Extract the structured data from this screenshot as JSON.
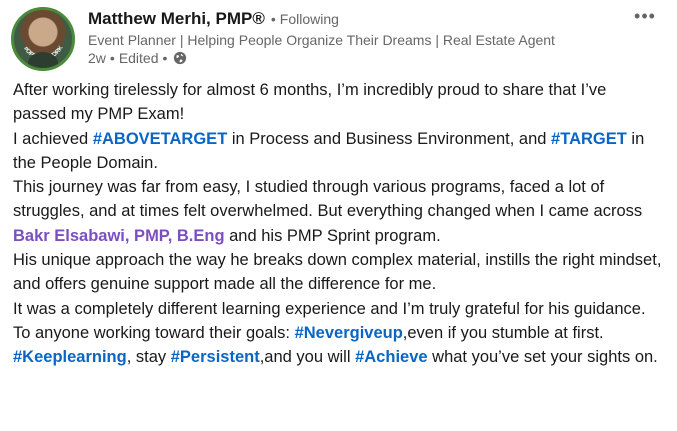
{
  "author": {
    "name": "Matthew Merhi, PMP®",
    "follow_sep": "•",
    "follow_status": "Following",
    "headline": "Event Planner | Helping People Organize Their Dreams | Real Estate Agent",
    "time": "2w",
    "meta_sep": "•",
    "edited": "Edited",
    "meta_sep2": "•",
    "avatar_badge": "#OPENTOWORK"
  },
  "menu": {
    "more_label": "•••"
  },
  "icons": {
    "more": "more-horizontal-icon",
    "visibility": "globe-icon"
  },
  "colors": {
    "hashtag": "#0a66c2",
    "mention": "#7b4fbf",
    "open_to_work": "#4a8a3a"
  },
  "post": {
    "p1": "After working tirelessly for almost 6 months, I’m incredibly proud to share that I’ve passed my PMP Exam!",
    "p2_a": "I achieved ",
    "p2_tag1": "#ABOVETARGET",
    "p2_b": " in Process and Business Environment, and ",
    "p2_tag2": "#TARGET",
    "p2_c": " in the People Domain.",
    "p3_a": "This journey was far from easy, I studied through various programs, faced a lot of struggles, and at times felt overwhelmed. But everything changed when I came across ",
    "p3_mention": "Bakr Elsabawi, PMP, B.Eng",
    "p3_b": " and his PMP Sprint program.",
    "p4": "His unique approach the way he breaks down complex material, instills the right mindset, and offers genuine support made all the difference for me.",
    "p5": "It was a completely different learning experience and I’m truly grateful for his guidance.",
    "p6_a": "To anyone working toward their goals: ",
    "p6_tag1": "#Nevergiveup",
    "p6_b": ",even if you stumble at first. ",
    "p6_tag2": "#Keeplearning",
    "p6_c": ", stay ",
    "p6_tag3": "#Persistent",
    "p6_d": ",and you will ",
    "p6_tag4": "#Achieve",
    "p6_e": " what you’ve set your sights on."
  }
}
